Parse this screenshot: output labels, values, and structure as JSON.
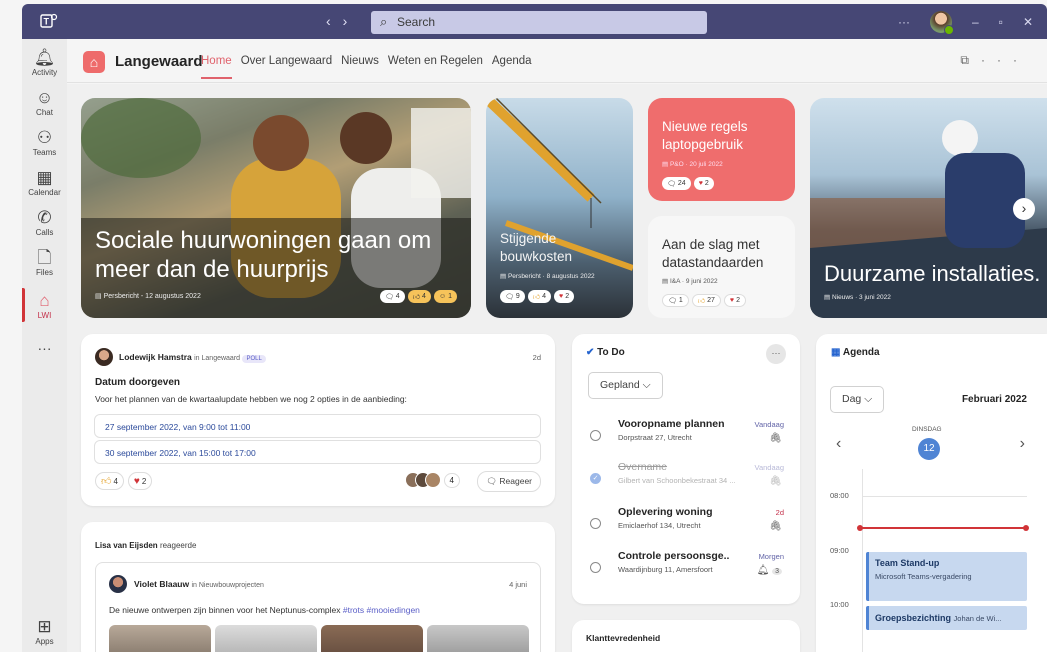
{
  "window": {
    "title_search_placeholder": "Search"
  },
  "rail": [
    {
      "label": "Activity",
      "icon": "bell-icon"
    },
    {
      "label": "Chat",
      "icon": "chat-icon"
    },
    {
      "label": "Teams",
      "icon": "teams-icon"
    },
    {
      "label": "Calendar",
      "icon": "calendar-icon"
    },
    {
      "label": "Calls",
      "icon": "phone-icon"
    },
    {
      "label": "Files",
      "icon": "file-icon"
    },
    {
      "label": "LWI",
      "icon": "lwi-app-icon"
    },
    {
      "label": "Apps",
      "icon": "apps-icon"
    }
  ],
  "app": {
    "name": "Langewaard",
    "tabs": [
      "Home",
      "Over Langewaard",
      "Nieuws",
      "Weten en Regelen",
      "Agenda"
    ],
    "active_tab": "Home"
  },
  "heroes": [
    {
      "title": "Sociale huurwoningen gaan om meer dan de huurprijs",
      "meta": "Persbericht - 12 augustus 2022",
      "reactions": [
        "4",
        "4",
        "1"
      ]
    },
    {
      "title": "Stijgende bouwkosten",
      "meta": "Persbericht · 8 augustus 2022",
      "reactions": [
        "9",
        "4",
        "2"
      ]
    },
    {
      "title": "Nieuwe regels laptopgebruik",
      "meta": "P&O · 20 juli 2022",
      "reactions": [
        "24",
        "2"
      ],
      "bg": "#ef6d6d"
    },
    {
      "title": "Aan de slag met datastandaarden",
      "meta": "I&A · 9 juni 2022",
      "reactions": [
        "1",
        "27",
        "2"
      ]
    },
    {
      "title": "Duurzame installaties.",
      "meta": "Nieuws · 3 juni 2022"
    }
  ],
  "poll": {
    "author": "Lodewijk Hamstra",
    "in_label": "in Langewaard",
    "badge": "POLL",
    "time": "2d",
    "title": "Datum doorgeven",
    "body": "Voor het plannen van de kwartaalupdate hebben we nog 2 opties in de aanbieding:",
    "options": [
      "27 september 2022, van 9:00 tot 11:00",
      "30 september 2022, van 15:00 tot 17:00"
    ],
    "reactions": [
      "4",
      "2"
    ],
    "participants": "4",
    "reply": "Reageer"
  },
  "activity": {
    "header_name": "Lisa van Eijsden",
    "header_action": "reageerde",
    "inner_author": "Violet Blaauw",
    "inner_in": "in Nieuwbouwprojecten",
    "inner_time": "4 juni",
    "inner_text": "De nieuwe ontwerpen zijn binnen voor het Neptunus-complex ",
    "inner_tags": "#trots #mooiedingen"
  },
  "todo": {
    "title": "To Do",
    "filter": "Gepland",
    "items": [
      {
        "title": "Vooropname plannen",
        "sub": "Dorpstraat 27, Utrecht",
        "due": "Vandaag",
        "done": false,
        "icon": "paperclip-icon"
      },
      {
        "title": "Overname",
        "sub": "Gilbert van Schoonbekestraat 34 ...",
        "due": "Vandaag",
        "done": true,
        "icon": "paperclip-icon"
      },
      {
        "title": "Oplevering woning",
        "sub": "Emiclaerhof 134, Utrecht",
        "due": "2d",
        "done": false,
        "icon": "paperclip-icon"
      },
      {
        "title": "Controle persoonsge..",
        "sub": "Waardijnburg 11, Amersfoort",
        "due": "Morgen",
        "done": false,
        "icon": "bell-icon",
        "count": "3"
      }
    ]
  },
  "klant": {
    "title": "Klanttevredenheid"
  },
  "agenda": {
    "title": "Agenda",
    "view": "Dag",
    "month": "Februari 2022",
    "weekday": "DINSDAG",
    "day": "12",
    "times": [
      "08:00",
      "09:00",
      "10:00"
    ],
    "events": [
      {
        "title": "Team Stand-up",
        "sub": "Microsoft Teams-vergadering"
      },
      {
        "title": "Groepsbezichting",
        "sub": "Johan de Wi..."
      }
    ]
  },
  "colors": {
    "accent": "#e0626c",
    "teams_purple": "#464775",
    "todo_blue": "#2564cf",
    "now_line": "#d13438"
  }
}
